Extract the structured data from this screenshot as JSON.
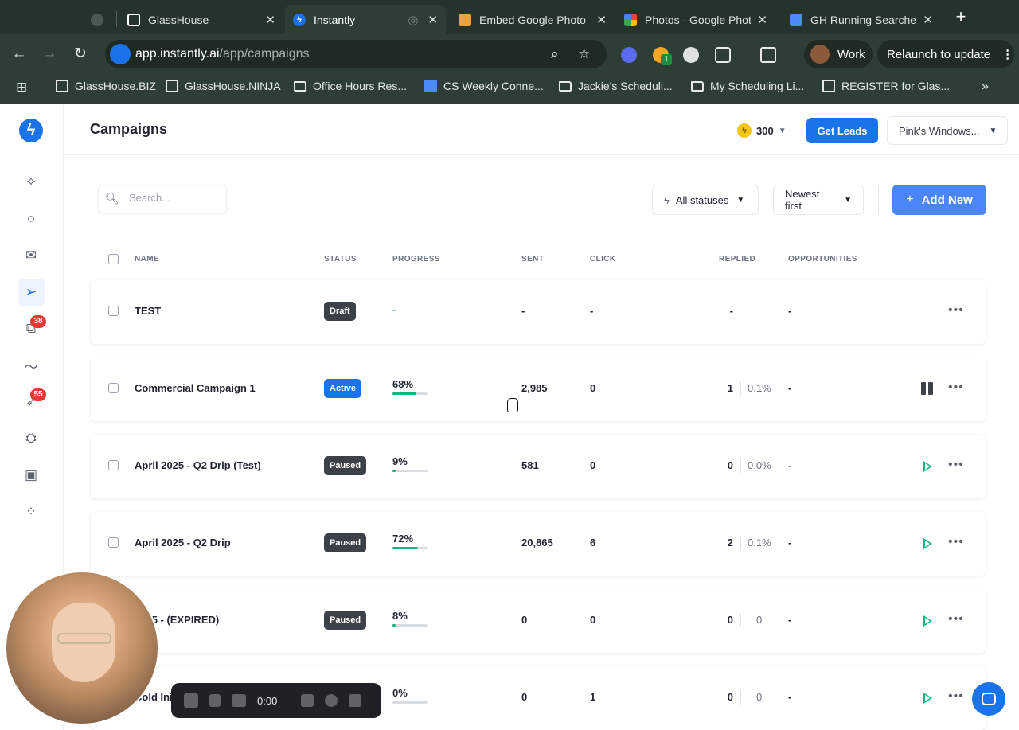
{
  "browser": {
    "tabs": [
      {
        "label": "",
        "active": false
      },
      {
        "label": "GlassHouse",
        "active": false
      },
      {
        "label": "Instantly",
        "active": true
      },
      {
        "label": "Embed Google Photo",
        "active": false
      },
      {
        "label": "Photos - Google Phot",
        "active": false
      },
      {
        "label": "GH Running Searches",
        "active": false
      }
    ],
    "url_host": "app.instantly.ai",
    "url_path": "/app/campaigns",
    "profile_label": "Work",
    "relaunch_label": "Relaunch to update",
    "extension_badge": "1",
    "bookmarks": [
      {
        "label": "GlassHouse.BIZ",
        "icon": "site"
      },
      {
        "label": "GlassHouse.NINJA",
        "icon": "site"
      },
      {
        "label": "Office Hours Res...",
        "icon": "folder"
      },
      {
        "label": "CS Weekly Conne...",
        "icon": "doc"
      },
      {
        "label": "Jackie's Scheduli...",
        "icon": "folder"
      },
      {
        "label": "My Scheduling Li...",
        "icon": "folder"
      },
      {
        "label": "REGISTER for Glas...",
        "icon": "site"
      }
    ]
  },
  "sidebar": {
    "badges": {
      "copy": "38",
      "rocket": "55"
    }
  },
  "header": {
    "title": "Campaigns",
    "credits": "300",
    "get_leads_label": "Get Leads",
    "workspace_label": "Pink's Windows..."
  },
  "filters": {
    "search_placeholder": "Search...",
    "status_label": "All statuses",
    "sort_label": "Newest first",
    "add_new_label": "Add New"
  },
  "table": {
    "columns": [
      "NAME",
      "STATUS",
      "PROGRESS",
      "SENT",
      "CLICK",
      "REPLIED",
      "OPPORTUNITIES"
    ],
    "rows": [
      {
        "name": "TEST",
        "status": "Draft",
        "progress": "-",
        "progress_fraction": null,
        "sent": "-",
        "click": "-",
        "replied": "-",
        "replied_pct": "",
        "opportunities": "-",
        "action": "none"
      },
      {
        "name": "Commercial Campaign 1",
        "status": "Active",
        "progress": "68%",
        "progress_fraction": 0.68,
        "sent": "2,985",
        "click": "0",
        "replied": "1",
        "replied_pct": "0.1%",
        "opportunities": "-",
        "action": "pause"
      },
      {
        "name": "April 2025 - Q2 Drip (Test)",
        "status": "Paused",
        "progress": "9%",
        "progress_fraction": 0.09,
        "sent": "581",
        "click": "0",
        "replied": "0",
        "replied_pct": "0.0%",
        "opportunities": "-",
        "action": "play"
      },
      {
        "name": "April 2025 - Q2 Drip",
        "status": "Paused",
        "progress": "72%",
        "progress_fraction": 0.72,
        "sent": "20,865",
        "click": "6",
        "replied": "2",
        "replied_pct": "0.1%",
        "opportunities": "-",
        "action": "play"
      },
      {
        "name": "2025 - (EXPIRED)",
        "status": "Paused",
        "progress": "8%",
        "progress_fraction": 0.08,
        "sent": "0",
        "click": "0",
        "replied": "0",
        "replied_pct": "0",
        "opportunities": "-",
        "action": "play"
      },
      {
        "name": "Cold Ini",
        "status": "Paused",
        "progress": "0%",
        "progress_fraction": 0.0,
        "sent": "0",
        "click": "1",
        "replied": "0",
        "replied_pct": "0",
        "opportunities": "-",
        "action": "play"
      }
    ]
  },
  "recorder": {
    "time": "0:00"
  },
  "colors": {
    "accent": "#1a73e8",
    "progress": "#16b47e",
    "chrome": "#2f3e34"
  }
}
